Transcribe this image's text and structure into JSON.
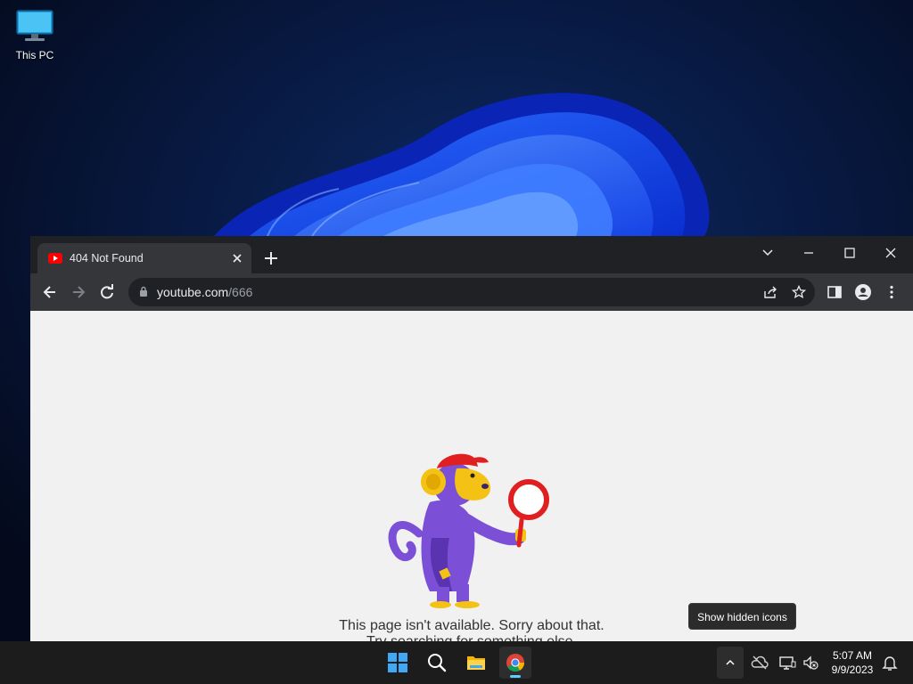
{
  "desktop": {
    "icons": [
      {
        "label": "This PC",
        "icon": "monitor-icon"
      }
    ]
  },
  "browser": {
    "tab": {
      "title": "404 Not Found",
      "favicon": "youtube-icon"
    },
    "url": {
      "host": "youtube.com",
      "path": "/666"
    },
    "page": {
      "message_line1": "This page isn't available. Sorry about that.",
      "message_line2": "Try searching for something else."
    }
  },
  "tooltip": {
    "text": "Show hidden icons"
  },
  "taskbar": {
    "apps": [
      "start-icon",
      "search-icon",
      "file-explorer-icon",
      "chrome-icon"
    ],
    "clock": {
      "time": "5:07 AM",
      "date": "9/9/2023"
    }
  },
  "colors": {
    "accent": "#60cdff",
    "browser_frame": "#202124",
    "browser_toolbar": "#35363a",
    "page_background": "#f1f1f1",
    "taskbar": "#1c1c1c"
  }
}
